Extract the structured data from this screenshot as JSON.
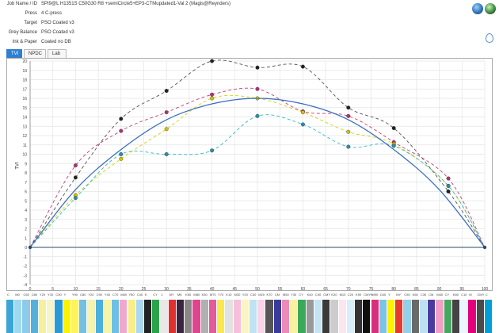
{
  "job": {
    "rows": [
      {
        "label": "Job Name / ID",
        "value": "SPI9@L H1351S C50G30 R8 +semiCircle5+EP3-CTMupdated1-Val 2 (Magis@Reynders)"
      },
      {
        "label": "Press",
        "value": "4 C-press"
      },
      {
        "label": "Target",
        "value": "PSO Coated v3"
      },
      {
        "label": "Grey Balance",
        "value": "PSO Coated v3"
      },
      {
        "label": "Ink & Paper",
        "value": "Coated no DB"
      }
    ]
  },
  "icons": {
    "globe": "globe-icon",
    "globe2": "globe-map-icon",
    "drop": "drop-icon"
  },
  "tabs": [
    {
      "label": "TVI",
      "active": true
    },
    {
      "label": "NPDC",
      "active": false
    },
    {
      "label": "Lab",
      "active": false
    }
  ],
  "chart_data": {
    "type": "line",
    "ylabel": "TVI",
    "xlim": [
      0,
      100
    ],
    "ylim": [
      -4,
      20
    ],
    "x_ticks": [
      "0",
      "5",
      "10",
      "15",
      "20",
      "25",
      "30",
      "35",
      "40",
      "45",
      "50",
      "55",
      "60",
      "65",
      "70",
      "75",
      "80",
      "85",
      "90",
      "95",
      "100"
    ],
    "y_ticks": [
      "-4",
      "-3",
      "-2",
      "-1",
      "0",
      "1",
      "2",
      "3",
      "4",
      "5",
      "6",
      "7",
      "8",
      "9",
      "10",
      "11",
      "12",
      "13",
      "14",
      "15",
      "16",
      "17",
      "18",
      "19",
      "20"
    ],
    "grid": true,
    "series": [
      {
        "name": "",
        "color": "#555555",
        "style": "dashed",
        "marker": "#222222",
        "x": [
          0,
          10,
          20,
          30,
          40,
          50,
          60,
          70,
          80,
          92,
          100
        ],
        "y": [
          0,
          7.5,
          13.8,
          16.8,
          20,
          19.3,
          19.4,
          15,
          12.8,
          6,
          0
        ]
      },
      {
        "name": "",
        "color": "#c0407a",
        "style": "dashed",
        "marker": "#b0307a",
        "x": [
          0,
          10,
          20,
          30,
          40,
          50,
          60,
          70,
          80,
          92,
          100
        ],
        "y": [
          0,
          8.8,
          12.5,
          14.5,
          16.4,
          17,
          14.6,
          14.1,
          11.3,
          7.4,
          0
        ]
      },
      {
        "name": "",
        "color": "#d6d000",
        "style": "dashed",
        "marker": "#d6c000",
        "x": [
          0,
          10,
          20,
          30,
          40,
          50,
          60,
          70,
          80,
          92,
          100
        ],
        "y": [
          0,
          5.6,
          9.5,
          12.7,
          16,
          16,
          14.5,
          12.4,
          11.1,
          6.6,
          0
        ]
      },
      {
        "name": "",
        "color": "#30b8c8",
        "style": "dashed",
        "marker": "#2a8fa8",
        "x": [
          0,
          10,
          20,
          30,
          40,
          50,
          60,
          70,
          80,
          92,
          100
        ],
        "y": [
          0,
          5.3,
          10,
          10,
          10.4,
          14.1,
          13.2,
          10.8,
          10.9,
          6.6,
          0
        ]
      },
      {
        "name": "",
        "color": "#3a6fc0",
        "style": "solid",
        "marker": "",
        "x": [
          0,
          10,
          20,
          30,
          40,
          50,
          60,
          70,
          80,
          90,
          100
        ],
        "y": [
          0,
          6.2,
          10.5,
          13.7,
          15.4,
          16,
          15.4,
          13.7,
          10.5,
          6.2,
          0
        ]
      }
    ]
  },
  "patches": [
    {
      "label": "C",
      "color": "#3aa6d6"
    },
    {
      "label": "M0",
      "color": "#9fd8ef"
    },
    {
      "label": "C60",
      "color": "#8ecbe8"
    },
    {
      "label": "C80",
      "color": "#55b0de"
    },
    {
      "label": "Y20",
      "color": "#f4f0a0"
    },
    {
      "label": "Y10",
      "color": "#f7f5c8"
    },
    {
      "label": "C90",
      "color": "#2c9ad2"
    },
    {
      "label": "Y",
      "color": "#fff200"
    },
    {
      "label": "Y90",
      "color": "#fff455"
    },
    {
      "label": "C80",
      "color": "#74bfe2"
    },
    {
      "label": "Y20",
      "color": "#f6f2b0"
    },
    {
      "label": "C90",
      "color": "#4ab0e0"
    },
    {
      "label": "Y40",
      "color": "#f8f4a8"
    },
    {
      "label": "C70",
      "color": "#6cc0e6"
    },
    {
      "label": "M60",
      "color": "#f2a8cc"
    },
    {
      "label": "Y50",
      "color": "#f6ee88"
    },
    {
      "label": "C40",
      "color": "#aad8f0"
    },
    {
      "label": "K",
      "color": "#222222"
    },
    {
      "label": "CY",
      "color": "#2aa44a"
    },
    {
      "label": "1",
      "color": "#e8e8e8"
    },
    {
      "label": "MY",
      "color": "#e0302e"
    },
    {
      "label": "MK",
      "color": "#3a2440"
    },
    {
      "label": "K50",
      "color": "#888888"
    },
    {
      "label": "M80",
      "color": "#e0448c"
    },
    {
      "label": "K30",
      "color": "#b0b0b0"
    },
    {
      "label": "M70",
      "color": "#e55a98"
    },
    {
      "label": "Y70",
      "color": "#fbe84a"
    },
    {
      "label": "K10",
      "color": "#e2e2e2"
    },
    {
      "label": "M30",
      "color": "#f6c0da"
    },
    {
      "label": "Y20",
      "color": "#fcf4c4"
    },
    {
      "label": "C30",
      "color": "#bfe2f4"
    },
    {
      "label": "M20",
      "color": "#f8d4e6"
    },
    {
      "label": "K70",
      "color": "#555555"
    },
    {
      "label": "CM",
      "color": "#3a3a9a"
    },
    {
      "label": "M50",
      "color": "#ec8ab8"
    },
    {
      "label": "Y30",
      "color": "#faf0a4"
    },
    {
      "label": "CY",
      "color": "#3aa85a"
    },
    {
      "label": "K40",
      "color": "#999999"
    },
    {
      "label": "C30",
      "color": "#c4e4f4"
    },
    {
      "label": "CMY",
      "color": "#3a3a3a"
    },
    {
      "label": "K20",
      "color": "#cccccc"
    },
    {
      "label": "M10",
      "color": "#fbe6f0"
    },
    {
      "label": "C20",
      "color": "#d8eef8"
    },
    {
      "label": "K90",
      "color": "#333333"
    },
    {
      "label": "CMYK",
      "color": "#101010"
    },
    {
      "label": "M90",
      "color": "#d8307e"
    },
    {
      "label": "C60",
      "color": "#7cc4e6"
    },
    {
      "label": "Y",
      "color": "#fff200"
    },
    {
      "label": "MY",
      "color": "#e63a30"
    },
    {
      "label": "C50",
      "color": "#94cfea"
    },
    {
      "label": "K60",
      "color": "#6a6a6a"
    },
    {
      "label": "C30",
      "color": "#bce0f2"
    },
    {
      "label": "CM",
      "color": "#4a3aa0"
    },
    {
      "label": "M40",
      "color": "#f0a0c6"
    },
    {
      "label": "CY",
      "color": "#46a860"
    },
    {
      "label": "K80",
      "color": "#444444"
    },
    {
      "label": "C10",
      "color": "#eaf6fc"
    },
    {
      "label": "M",
      "color": "#e4007c"
    },
    {
      "label": "CMY",
      "color": "#4a4a4a"
    },
    {
      "label": "C",
      "color": "#00a0d6"
    }
  ]
}
